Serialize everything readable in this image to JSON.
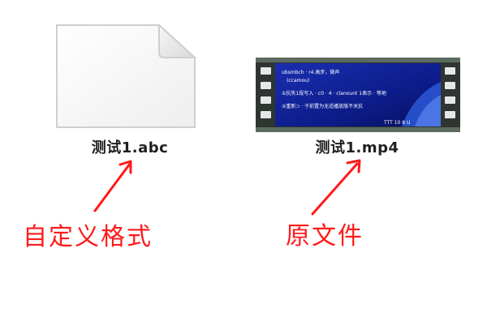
{
  "files": [
    {
      "name": "测试1.abc",
      "icon": "blank-document-icon"
    },
    {
      "name": "测试1.mp4",
      "icon": "video-file-icon"
    }
  ],
  "video_thumbnail": {
    "lines": [
      "ubsmbch · r4.高步，微声",
      "(ccamou)",
      "①抗失1段写入 · c0 · 4 · clanount 1表示 · 等地",
      "②重新⊃ · 于前置为无适播放版不关抗"
    ],
    "footer": "TTT 10 8 U"
  },
  "annotations": {
    "custom_format": "自定义格式",
    "original_file": "原文件"
  },
  "colors": {
    "annotation": "#ff1a1a",
    "label": "#1f1f1f"
  }
}
